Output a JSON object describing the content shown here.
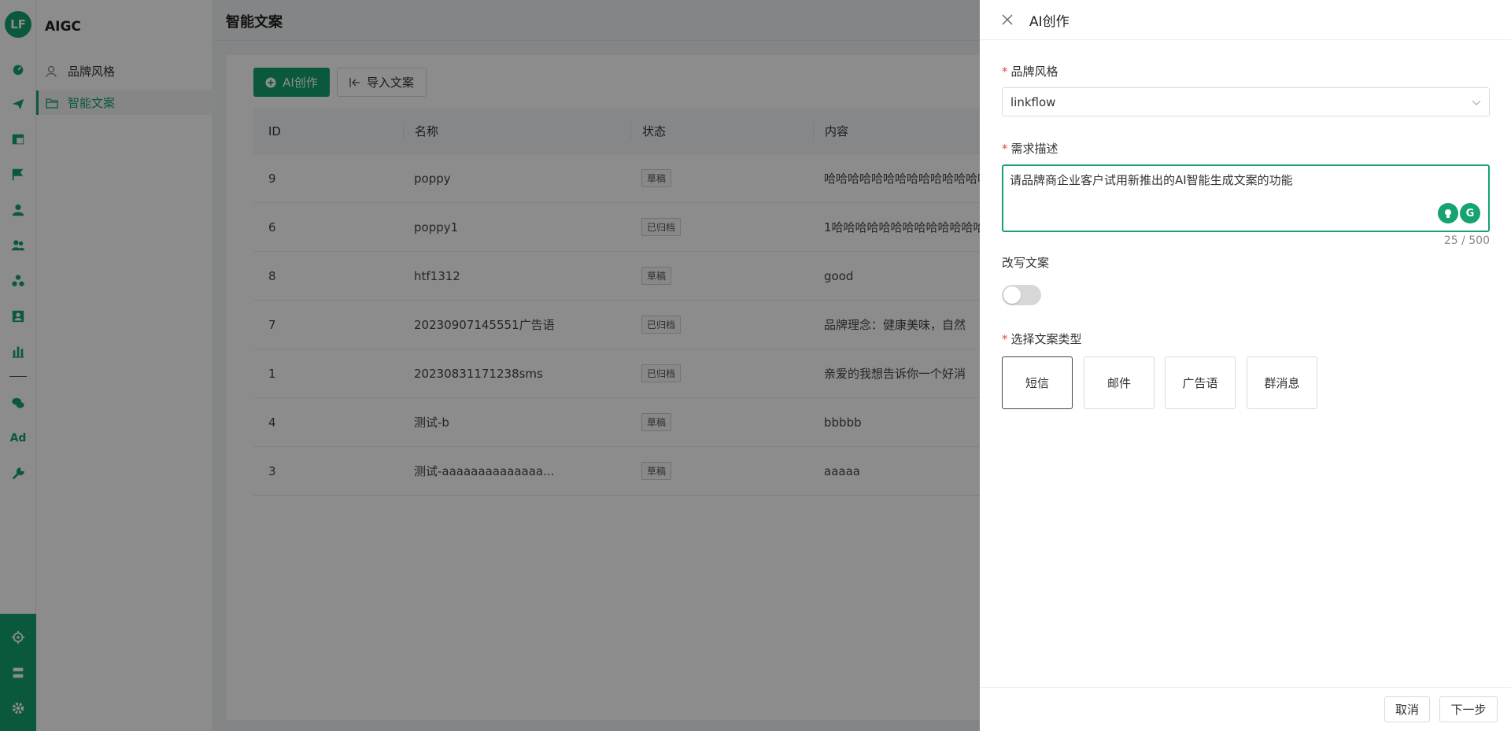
{
  "app": {
    "logo_text": "LF",
    "title": "AIGC"
  },
  "rail_icons": [
    "dashboard-icon",
    "send-icon",
    "layout-icon",
    "flag-icon",
    "user-icon",
    "users-icon",
    "group-icon",
    "portrait-icon",
    "bar-chart-icon",
    "wechat-icon",
    "ad-icon",
    "wrench-icon",
    "ai-icon",
    "server-icon",
    "gear-icon"
  ],
  "rail_ad_text": "Ad",
  "menu": {
    "items": [
      {
        "label": "品牌风格",
        "icon": "user-outline-icon"
      },
      {
        "label": "智能文案",
        "icon": "folder-icon",
        "active": true
      }
    ]
  },
  "main": {
    "page_title": "智能文案",
    "buttons": {
      "ai_create": "AI创作",
      "import": "导入文案"
    },
    "table": {
      "columns": [
        "ID",
        "名称",
        "状态",
        "内容"
      ],
      "rows": [
        {
          "id": "9",
          "name": "poppy",
          "status": "草稿",
          "content": "哈哈哈哈哈哈哈哈哈哈哈哈哈哈"
        },
        {
          "id": "6",
          "name": "poppy1",
          "status": "已归档",
          "content": "1哈哈哈哈哈哈哈哈哈哈哈哈哈"
        },
        {
          "id": "8",
          "name": "htf1312",
          "status": "草稿",
          "content": "good"
        },
        {
          "id": "7",
          "name": "20230907145551广告语",
          "status": "已归档",
          "content": "品牌理念：健康美味，自然"
        },
        {
          "id": "1",
          "name": "20230831171238sms",
          "status": "已归档",
          "content": "亲爱的我想告诉你一个好消"
        },
        {
          "id": "4",
          "name": "测试-b",
          "status": "草稿",
          "content": "bbbbb"
        },
        {
          "id": "3",
          "name": "测试-aaaaaaaaaaaaaa...",
          "status": "草稿",
          "content": "aaaaa"
        }
      ]
    }
  },
  "drawer": {
    "title": "AI创作",
    "brand_style": {
      "label": "品牌风格",
      "value": "linkflow"
    },
    "requirement": {
      "label": "需求描述",
      "value": "请品牌商企业客户试用新推出的AI智能生成文案的功能",
      "counter": "25 / 500",
      "grammarly_letter": "G"
    },
    "rewrite": {
      "label": "改写文案",
      "enabled": false
    },
    "type": {
      "label": "选择文案类型",
      "options": [
        "短信",
        "邮件",
        "广告语",
        "群消息"
      ],
      "selected": "短信"
    },
    "footer": {
      "cancel": "取消",
      "next": "下一步"
    }
  },
  "colors": {
    "accent": "#15a36f",
    "required": "#e5484d"
  }
}
